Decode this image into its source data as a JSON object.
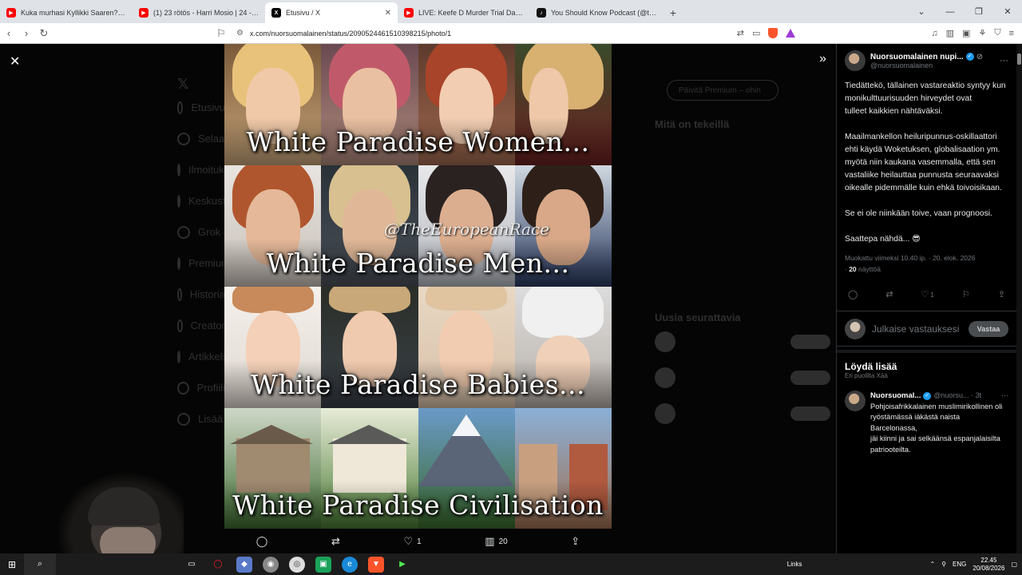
{
  "browser": {
    "tabs": [
      {
        "label": "Kuka murhasi Kyllikki Saaren? | 23 ri...",
        "favicon_color": "#ff0000",
        "active": false
      },
      {
        "label": "(1) 23 rötös - Harri Mosio | 24 - YouT...",
        "favicon_color": "#ff0000",
        "active": false
      },
      {
        "label": "Etusivu / X",
        "favicon_color": "#000000",
        "active": true
      },
      {
        "label": "LIVE: Keefe D Murder Trial Day 4 | Off...",
        "favicon_color": "#ff0000",
        "active": false
      },
      {
        "label": "You Should Know Podcast (@thepsf...",
        "favicon_color": "#111111",
        "active": false
      }
    ],
    "url": "x.com/nuorsuomalainen/status/2090524461510398215/photo/1"
  },
  "photo": {
    "watermark": "@TheEuropeanRace",
    "bands": [
      {
        "title": "White Paradise Women..."
      },
      {
        "title": "White Paradise Men..."
      },
      {
        "title": "White Paradise Babies..."
      },
      {
        "title": "White Paradise Civilisation"
      }
    ],
    "stats": {
      "likes": "1",
      "views": "20"
    }
  },
  "ghost_nav": [
    "Etusivu",
    "Selaa",
    "Ilmoitukset",
    "Keskustelu",
    "Grok",
    "Premium",
    "Historia",
    "Creator",
    "Artikkelit",
    "Profiili",
    "Lisää"
  ],
  "ghost_right": {
    "premium_btn": "Päivitä Premium – ohin",
    "trending_title": "Mitä on tekeillä",
    "follow_title": "Uusia seurattavia"
  },
  "sidebar": {
    "author": {
      "name": "Nuorsuomalainen nupi...",
      "handle": "@nuorsuomalainen"
    },
    "tweet_text": "Tiedättekö, tällainen vastareaktio syntyy kun monikulttuurisuuden hirveydet ovat\ntulleet kaikkien nähtäväksi.\n\nMaailmankellon heiluripunnus-oskillaattori\nehti käydä Woketuksen, globalisaation ym.\nmyötä niin kaukana vasemmalla, että sen\nvastaliike heilauttaa punnusta seuraavaksi oikealle pidemmälle kuin ehkä toivoisikaan.\n\nSe ei ole niinkään toive, vaan prognoosi.\n\nSaattepa nähdä... 😎",
    "meta": {
      "edited": "Muokattu viimeksi 10.40 ip. · 20. elok. 2026",
      "views_count": "20",
      "views_label": "näyttöä"
    },
    "actions": {
      "likes": "1"
    },
    "reply": {
      "placeholder": "Julkaise vastauksesi",
      "button": "Vastaa"
    },
    "find_more": {
      "title": "Löydä lisää",
      "subtitle": "Eri puolilta Xää"
    },
    "recommendation": {
      "name": "Nuorsuomal...",
      "handle": "@nuorsu... · 3t",
      "text": "Pohjoisafrikkalainen muslimirikollinen oli\nryöstämässä iäkästä naista Barcelonassa,\njäi kiinni ja sai selkäänsä espanjalaisilta\npatriooteilta."
    }
  },
  "taskbar": {
    "links": "Links",
    "lang": "ENG",
    "time": "22.45",
    "date": "20/08/2026"
  }
}
